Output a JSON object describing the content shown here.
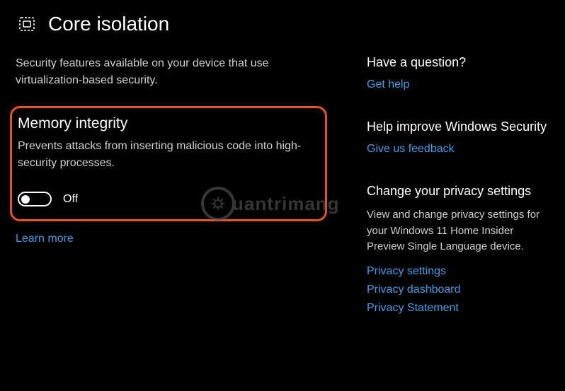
{
  "header": {
    "title": "Core isolation"
  },
  "main": {
    "description": "Security features available on your device that use virtualization-based security.",
    "memory_integrity": {
      "title": "Memory integrity",
      "description": "Prevents attacks from inserting malicious code into high-security processes.",
      "toggle_state": "Off"
    },
    "learn_more": "Learn more"
  },
  "sidebar": {
    "question": {
      "heading": "Have a question?",
      "link": "Get help"
    },
    "improve": {
      "heading": "Help improve Windows Security",
      "link": "Give us feedback"
    },
    "privacy": {
      "heading": "Change your privacy settings",
      "description": "View and change privacy settings for your Windows 11 Home Insider Preview Single Language device.",
      "links": [
        "Privacy settings",
        "Privacy dashboard",
        "Privacy Statement"
      ]
    }
  },
  "watermark": "uantrimang"
}
